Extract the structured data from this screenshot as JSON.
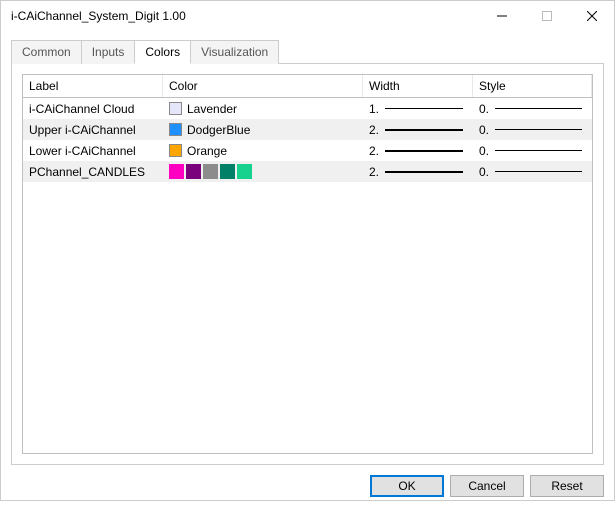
{
  "window": {
    "title": "i-CAiChannel_System_Digit 1.00"
  },
  "tabs": {
    "common": "Common",
    "inputs": "Inputs",
    "colors": "Colors",
    "visualization": "Visualization"
  },
  "headers": {
    "label": "Label",
    "color": "Color",
    "width": "Width",
    "style": "Style"
  },
  "rows": [
    {
      "label": "i-CAiChannel Cloud",
      "colorName": "Lavender",
      "swatch": "#e6e6fa",
      "width": "1.",
      "widthThin": true,
      "style": "0.",
      "palette": null
    },
    {
      "label": "Upper i-CAiChannel",
      "colorName": "DodgerBlue",
      "swatch": "#1e90ff",
      "width": "2.",
      "widthThin": false,
      "style": "0.",
      "palette": null
    },
    {
      "label": "Lower i-CAiChannel",
      "colorName": "Orange",
      "swatch": "#ffa500",
      "width": "2.",
      "widthThin": false,
      "style": "0.",
      "palette": null
    },
    {
      "label": "PChannel_CANDLES",
      "colorName": "",
      "swatch": null,
      "width": "2.",
      "widthThin": false,
      "style": "0.",
      "palette": [
        "#ff00c3",
        "#7b007b",
        "#8c8c8c",
        "#008066",
        "#17d28f"
      ]
    }
  ],
  "buttons": {
    "ok": "OK",
    "cancel": "Cancel",
    "reset": "Reset"
  }
}
